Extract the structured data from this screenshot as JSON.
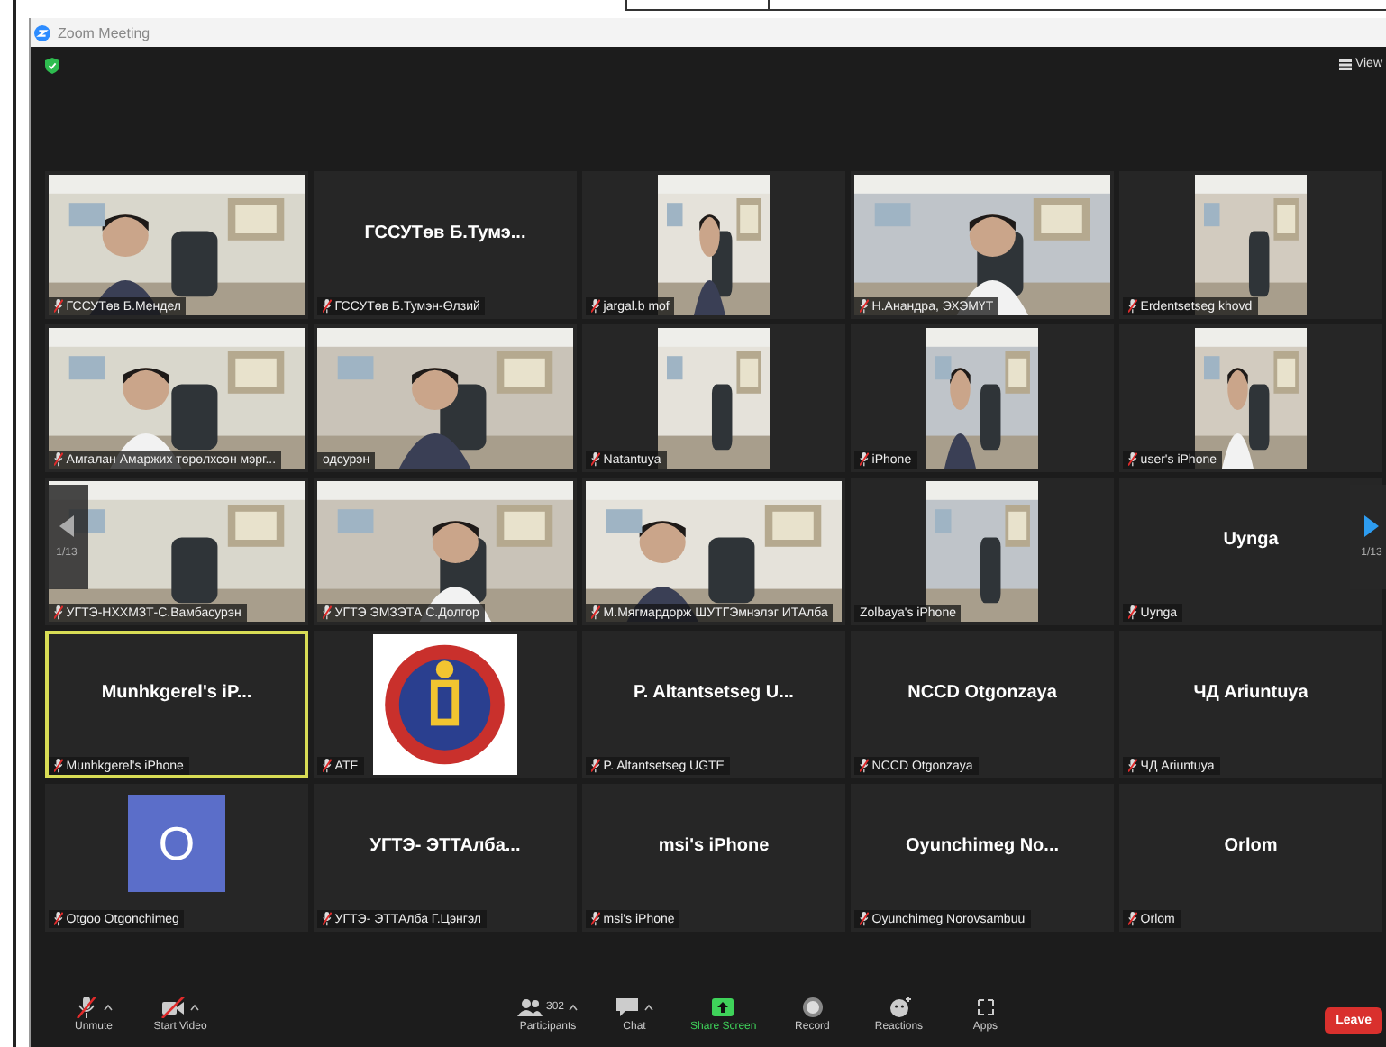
{
  "window": {
    "title": "Zoom Meeting"
  },
  "top_bar": {
    "view_label": "View"
  },
  "pager": {
    "left": "1/13",
    "right": "1/13"
  },
  "tiles": [
    {
      "kind": "video",
      "name": "ГССУТөв Б.Мендел",
      "muted": true,
      "speaking": false
    },
    {
      "kind": "name",
      "heading": "ГССУТөв Б.Тумэ...",
      "name": "ГССУТөв Б.Тумэн-Өлзий",
      "muted": true,
      "speaking": false
    },
    {
      "kind": "phone_video",
      "name": "jargal.b mof",
      "muted": true,
      "speaking": false
    },
    {
      "kind": "video",
      "name": "Н.Анандра, ЭХЭМҮТ",
      "muted": true,
      "speaking": false
    },
    {
      "kind": "phone_video",
      "name": "Erdentsetseg khovd",
      "muted": true,
      "speaking": false
    },
    {
      "kind": "video",
      "name": "Амгалан Амаржих төрөлхсөн мэрг...",
      "muted": true,
      "speaking": false
    },
    {
      "kind": "video",
      "name": "одсурэн",
      "muted": false,
      "speaking": false
    },
    {
      "kind": "phone_video",
      "name": "Natantuya",
      "muted": true,
      "speaking": false
    },
    {
      "kind": "phone_video",
      "name": "iPhone",
      "muted": true,
      "speaking": false
    },
    {
      "kind": "phone_video",
      "name": "user's iPhone",
      "muted": true,
      "speaking": false
    },
    {
      "kind": "video",
      "name": "УГТЭ-НХХМЗТ-С.Вамбасурэн",
      "muted": true,
      "speaking": false
    },
    {
      "kind": "video",
      "name": "УГТЭ ЭМЗЭТА С.Долгор",
      "muted": true,
      "speaking": false
    },
    {
      "kind": "video",
      "name": "М.Мягмардорж ШУТГЭмнэлэг ИТАлба",
      "muted": true,
      "speaking": false
    },
    {
      "kind": "phone_video",
      "name": "Zolbaya's iPhone",
      "muted": false,
      "speaking": false
    },
    {
      "kind": "name",
      "heading": "Uynga",
      "name": "Uynga",
      "muted": true,
      "speaking": false
    },
    {
      "kind": "name",
      "heading": "Munhkgerel's iP...",
      "name": "Munhkgerel's iPhone",
      "muted": true,
      "speaking": true
    },
    {
      "kind": "emblem",
      "name": "ATF",
      "muted": true,
      "speaking": false
    },
    {
      "kind": "name",
      "heading": "P. Altantsetseg U...",
      "name": "P. Altantsetseg UGTE",
      "muted": true,
      "speaking": false
    },
    {
      "kind": "name",
      "heading": "NCCD Otgonzaya",
      "name": "NCCD Otgonzaya",
      "muted": true,
      "speaking": false
    },
    {
      "kind": "name",
      "heading": "ЧД Ariuntuya",
      "name": "ЧД Ariuntuya",
      "muted": true,
      "speaking": false
    },
    {
      "kind": "avatar",
      "heading": "O",
      "name": "Otgoo Otgonchimeg",
      "muted": true,
      "speaking": false
    },
    {
      "kind": "name",
      "heading": "УГТЭ- ЭТТАлба...",
      "name": "УГТЭ- ЭТТАлба Г.Цэнгэл",
      "muted": true,
      "speaking": false
    },
    {
      "kind": "name",
      "heading": "msi's iPhone",
      "name": "msi's iPhone",
      "muted": true,
      "speaking": false
    },
    {
      "kind": "name",
      "heading": "Oyunchimeg  No...",
      "name": "Oyunchimeg Norovsambuu",
      "muted": true,
      "speaking": false
    },
    {
      "kind": "name",
      "heading": "Orlom",
      "name": "Orlom",
      "muted": true,
      "speaking": false
    }
  ],
  "toolbar": {
    "left": [
      {
        "kind": "mic",
        "label": "Unmute"
      },
      {
        "kind": "video",
        "label": "Start Video"
      }
    ],
    "center": [
      {
        "kind": "participants",
        "label": "Participants",
        "count": "302"
      },
      {
        "kind": "chat",
        "label": "Chat"
      },
      {
        "kind": "share",
        "label": "Share Screen"
      },
      {
        "kind": "record",
        "label": "Record"
      },
      {
        "kind": "reactions",
        "label": "Reactions"
      },
      {
        "kind": "apps",
        "label": "Apps"
      }
    ],
    "leave": "Leave"
  }
}
